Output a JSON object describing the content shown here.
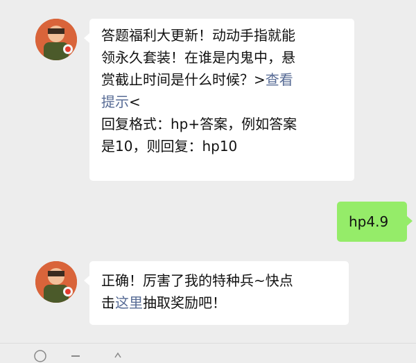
{
  "messages": [
    {
      "side": "incoming",
      "line1": "答题福利大更新！动动手指就能",
      "line2": "领永久套装！在谁是内鬼中，悬",
      "line3_text": "赏截止时间是什么时候？>",
      "line3_link": "查看",
      "line4_link": "提示",
      "line4_text": "<",
      "line5": "回复格式：hp+答案，例如答案",
      "line6": "是10，则回复：hp10"
    },
    {
      "side": "outgoing",
      "text": "hp4.9"
    },
    {
      "side": "incoming",
      "line1": "正确！厉害了我的特种兵~快点",
      "line2_pre": "击",
      "line2_link": "这里",
      "line2_post": "抽取奖励吧！"
    }
  ],
  "bottom_bar": {
    "icons": [
      "voice-icon",
      "emoji-icon",
      "more-icon"
    ]
  },
  "colors": {
    "background": "#ededed",
    "incoming_bubble": "#ffffff",
    "outgoing_bubble": "#95ec69",
    "link": "#576b95"
  }
}
